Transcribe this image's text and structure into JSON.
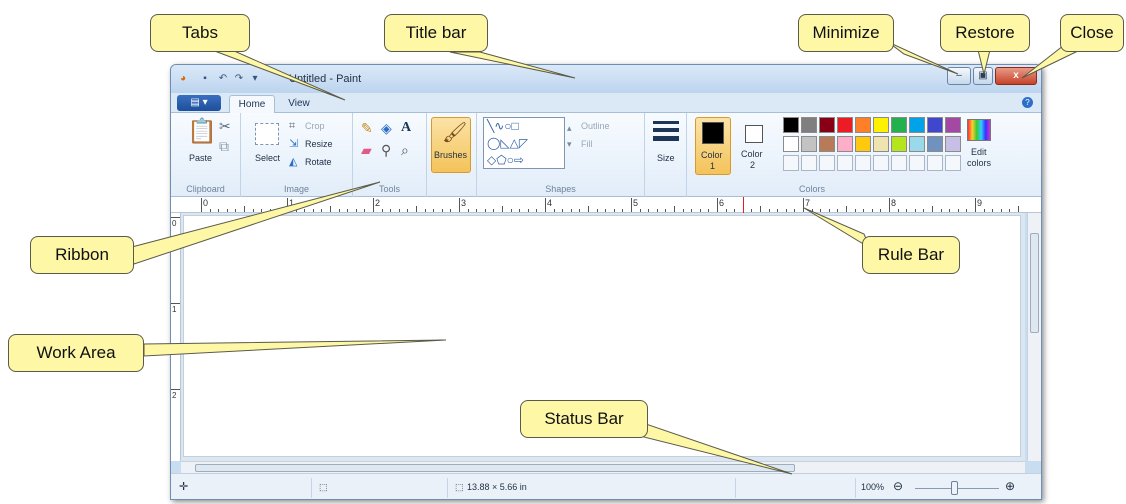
{
  "window": {
    "title": "Untitled - Paint",
    "controls": {
      "minimize": "‒",
      "restore": "▣",
      "close": "x"
    }
  },
  "tabs": {
    "file": "▤ ▾",
    "home": "Home",
    "view": "View",
    "help": "?"
  },
  "ribbon": {
    "clipboard": {
      "paste": "Paste",
      "label": "Clipboard"
    },
    "image": {
      "select": "Select",
      "crop": "Crop",
      "resize": "Resize",
      "rotate": "Rotate",
      "label": "Image"
    },
    "tools": {
      "label": "Tools"
    },
    "brushes": {
      "label": "Brushes"
    },
    "shapes": {
      "outline": "Outline",
      "fill": "Fill",
      "label": "Shapes"
    },
    "size": {
      "label": "Size"
    },
    "colors": {
      "color1": "Color",
      "color1_num": "1",
      "color2": "Color",
      "color2_num": "2",
      "edit": "Edit",
      "edit2": "colors",
      "label": "Colors",
      "palette_row1": [
        "#000000",
        "#7f7f7f",
        "#880015",
        "#ed1c24",
        "#ff7f27",
        "#fff200",
        "#22b14c",
        "#00a2e8",
        "#3f48cc",
        "#a349a4"
      ],
      "palette_row2": [
        "#ffffff",
        "#c3c3c3",
        "#b97a57",
        "#ffaec9",
        "#ffc90e",
        "#efe4b0",
        "#b5e61d",
        "#99d9ea",
        "#7092be",
        "#c8bfe7"
      ],
      "color1_value": "#000000",
      "color2_value": "#ffffff"
    }
  },
  "ruler": {
    "numbers": [
      "0",
      "1",
      "2",
      "3",
      "4",
      "5",
      "6",
      "7",
      "8",
      "9"
    ],
    "vertical": [
      "0",
      "1",
      "2"
    ]
  },
  "statusbar": {
    "size": "13.88 × 5.66 in",
    "zoom": "100%"
  },
  "callouts": {
    "tabs": "Tabs",
    "title_bar": "Title bar",
    "minimize": "Minimize",
    "restore": "Restore",
    "close": "Close",
    "ribbon": "Ribbon",
    "rule_bar": "Rule Bar",
    "work_area": "Work Area",
    "status_bar": "Status Bar"
  }
}
